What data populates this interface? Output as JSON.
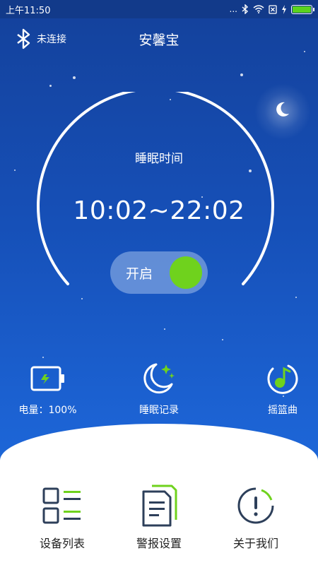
{
  "status_bar": {
    "time": "上午11:50",
    "dots": "..."
  },
  "header": {
    "bluetooth_status": "未连接",
    "title": "安馨宝"
  },
  "sleep": {
    "label": "睡眠时间",
    "time": "10:02~22:02"
  },
  "toggle": {
    "label": "开启",
    "on": true
  },
  "features": [
    {
      "label": "电量：100%",
      "icon": "battery-charging-icon"
    },
    {
      "label": "睡眠记录",
      "icon": "moon-stars-icon"
    },
    {
      "label": "摇篮曲",
      "icon": "music-note-icon"
    }
  ],
  "bottom_nav": [
    {
      "label": "设备列表",
      "icon": "device-list-icon"
    },
    {
      "label": "警报设置",
      "icon": "alarm-settings-icon"
    },
    {
      "label": "关于我们",
      "icon": "info-icon"
    }
  ],
  "colors": {
    "accent_green": "#6fd21d",
    "background_blue": "#1650b8",
    "icon_dark": "#2d3f5a"
  }
}
